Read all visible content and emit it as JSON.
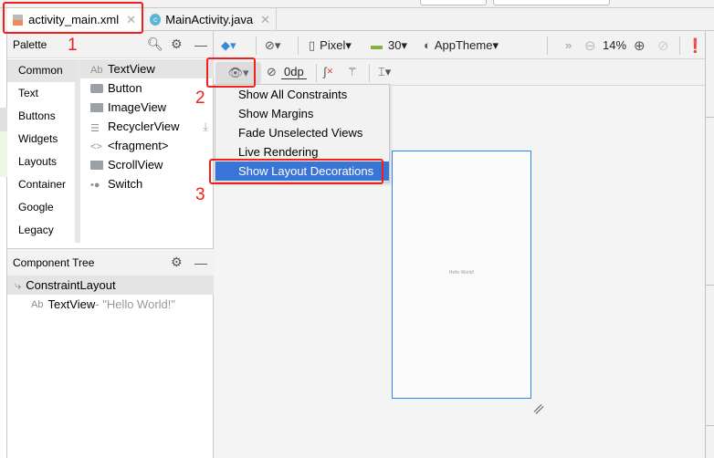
{
  "tabs": [
    {
      "label": "activity_main.xml",
      "icon": "xml-layout-icon",
      "active": true
    },
    {
      "label": "MainActivity.java",
      "icon": "class-c-icon",
      "active": false
    }
  ],
  "palette": {
    "title": "Palette",
    "categories": [
      "Common",
      "Text",
      "Buttons",
      "Widgets",
      "Layouts",
      "Container",
      "Google",
      "Legacy"
    ],
    "selected_category": "Common",
    "items": [
      {
        "label": "TextView",
        "icon": "ab"
      },
      {
        "label": "Button",
        "icon": "button-icon"
      },
      {
        "label": "ImageView",
        "icon": "image-icon"
      },
      {
        "label": "RecyclerView",
        "icon": "list-icon"
      },
      {
        "label": "<fragment>",
        "icon": "code-icon"
      },
      {
        "label": "ScrollView",
        "icon": "scrollview-icon"
      },
      {
        "label": "Switch",
        "icon": "switch-icon"
      }
    ]
  },
  "component_tree": {
    "title": "Component Tree",
    "root": "ConstraintLayout",
    "child": "TextView",
    "child_text": "- \"Hello World!\""
  },
  "toolbar": {
    "device": "Pixel",
    "api": "30",
    "theme": "AppTheme",
    "zoom": "14%",
    "margin": "0dp",
    "overflow": "»"
  },
  "view_options_menu": {
    "items": [
      "Show All Constraints",
      "Show Margins",
      "Fade Unselected Views",
      "Live Rendering",
      "Show Layout Decorations"
    ],
    "highlighted": "Show Layout Decorations"
  },
  "preview": {
    "text": "Hello World!"
  },
  "annotations": {
    "n1": "1",
    "n2": "2",
    "n3": "3"
  },
  "colors": {
    "accent": "#3875d7",
    "annotation": "#f2201a",
    "blueprint": "#2b87f0"
  }
}
